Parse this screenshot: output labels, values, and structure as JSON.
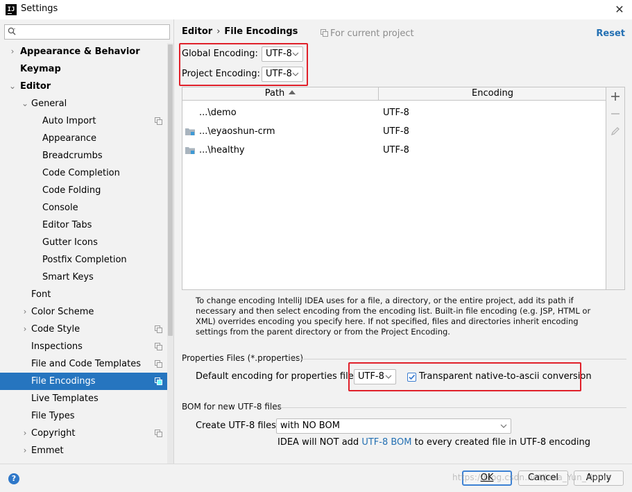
{
  "window": {
    "title": "Settings",
    "app_icon_text": "IJ",
    "close_glyph": "✕"
  },
  "search": {
    "value": "",
    "placeholder": ""
  },
  "tree": [
    {
      "label": "Appearance & Behavior",
      "level": 0,
      "arrow": "›",
      "bold": true,
      "badge": false,
      "selected": false
    },
    {
      "label": "Keymap",
      "level": 0,
      "arrow": "",
      "bold": true,
      "badge": false,
      "selected": false
    },
    {
      "label": "Editor",
      "level": 0,
      "arrow": "⌄",
      "bold": true,
      "badge": false,
      "selected": false
    },
    {
      "label": "General",
      "level": 1,
      "arrow": "⌄",
      "bold": false,
      "badge": false,
      "selected": false
    },
    {
      "label": "Auto Import",
      "level": 2,
      "arrow": "",
      "bold": false,
      "badge": true,
      "selected": false
    },
    {
      "label": "Appearance",
      "level": 2,
      "arrow": "",
      "bold": false,
      "badge": false,
      "selected": false
    },
    {
      "label": "Breadcrumbs",
      "level": 2,
      "arrow": "",
      "bold": false,
      "badge": false,
      "selected": false
    },
    {
      "label": "Code Completion",
      "level": 2,
      "arrow": "",
      "bold": false,
      "badge": false,
      "selected": false
    },
    {
      "label": "Code Folding",
      "level": 2,
      "arrow": "",
      "bold": false,
      "badge": false,
      "selected": false
    },
    {
      "label": "Console",
      "level": 2,
      "arrow": "",
      "bold": false,
      "badge": false,
      "selected": false
    },
    {
      "label": "Editor Tabs",
      "level": 2,
      "arrow": "",
      "bold": false,
      "badge": false,
      "selected": false
    },
    {
      "label": "Gutter Icons",
      "level": 2,
      "arrow": "",
      "bold": false,
      "badge": false,
      "selected": false
    },
    {
      "label": "Postfix Completion",
      "level": 2,
      "arrow": "",
      "bold": false,
      "badge": false,
      "selected": false
    },
    {
      "label": "Smart Keys",
      "level": 2,
      "arrow": "",
      "bold": false,
      "badge": false,
      "selected": false
    },
    {
      "label": "Font",
      "level": 1,
      "arrow": "",
      "bold": false,
      "badge": false,
      "selected": false
    },
    {
      "label": "Color Scheme",
      "level": 1,
      "arrow": "›",
      "bold": false,
      "badge": false,
      "selected": false
    },
    {
      "label": "Code Style",
      "level": 1,
      "arrow": "›",
      "bold": false,
      "badge": true,
      "selected": false
    },
    {
      "label": "Inspections",
      "level": 1,
      "arrow": "",
      "bold": false,
      "badge": true,
      "selected": false
    },
    {
      "label": "File and Code Templates",
      "level": 1,
      "arrow": "",
      "bold": false,
      "badge": true,
      "selected": false
    },
    {
      "label": "File Encodings",
      "level": 1,
      "arrow": "",
      "bold": false,
      "badge": true,
      "selected": true
    },
    {
      "label": "Live Templates",
      "level": 1,
      "arrow": "",
      "bold": false,
      "badge": false,
      "selected": false
    },
    {
      "label": "File Types",
      "level": 1,
      "arrow": "",
      "bold": false,
      "badge": false,
      "selected": false
    },
    {
      "label": "Copyright",
      "level": 1,
      "arrow": "›",
      "bold": false,
      "badge": true,
      "selected": false
    },
    {
      "label": "Emmet",
      "level": 1,
      "arrow": "›",
      "bold": false,
      "badge": false,
      "selected": false
    }
  ],
  "breadcrumb": {
    "parent": "Editor",
    "separator": "›",
    "current": "File Encodings"
  },
  "for_project": "For current project",
  "reset": "Reset",
  "global_encoding": {
    "label": "Global Encoding:",
    "value": "UTF-8"
  },
  "project_encoding": {
    "label": "Project Encoding:",
    "value": "UTF-8"
  },
  "table": {
    "columns": [
      "Path",
      "Encoding"
    ],
    "rows": [
      {
        "path": "...\\demo",
        "encoding": "UTF-8",
        "folder": false
      },
      {
        "path": "...\\eyaoshun-crm",
        "encoding": "UTF-8",
        "folder": true
      },
      {
        "path": "...\\healthy",
        "encoding": "UTF-8",
        "folder": true
      }
    ]
  },
  "info_text": "To change encoding IntelliJ IDEA uses for a file, a directory, or the entire project, add its path if necessary and then select encoding from the encoding list. Built-in file encoding (e.g. JSP, HTML or XML) overrides encoding you specify here. If not specified, files and directories inherit encoding settings from the parent directory or from the Project Encoding.",
  "properties": {
    "section": "Properties Files (*.properties)",
    "default_label": "Default encoding for properties files:",
    "value": "UTF-8",
    "checkbox_label": "Transparent native-to-ascii conversion",
    "checked": true
  },
  "bom": {
    "section": "BOM for new UTF-8 files",
    "create_label": "Create UTF-8 files:",
    "value": "with NO BOM",
    "note_prefix": "IDEA will NOT add ",
    "note_link": "UTF-8 BOM",
    "note_suffix": " to every created file in UTF-8 encoding"
  },
  "buttons": {
    "ok": "OK",
    "cancel": "Cancel",
    "apply": "Apply"
  },
  "help": "?",
  "watermark": "https://blog.csdn.net/Java_Yun_Home",
  "colors": {
    "accent": "#2675bf",
    "link": "#2470b3",
    "highlight": "#e0202a"
  }
}
